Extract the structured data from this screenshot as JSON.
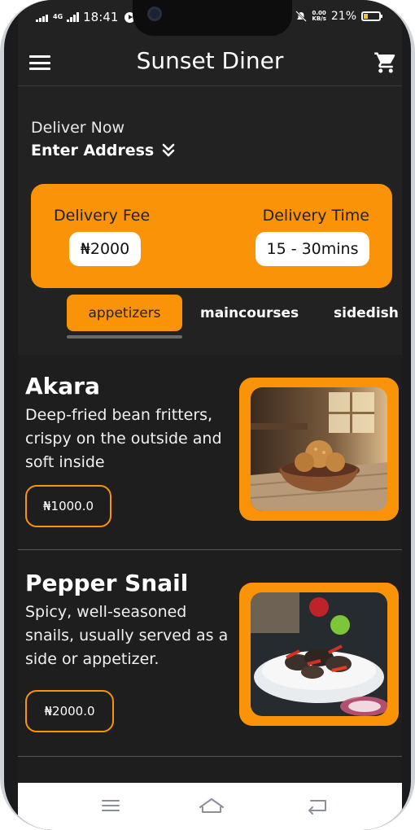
{
  "status_bar": {
    "network": "4G",
    "time": "18:41",
    "speed_top": "0.00",
    "speed_bottom": "KB/s",
    "battery": "21%"
  },
  "app": {
    "title": "Sunset Diner"
  },
  "delivery": {
    "deliver_now": "Deliver Now",
    "address": "Enter Address",
    "fee_label": "Delivery Fee",
    "fee_value": "₦2000",
    "time_label": "Delivery Time",
    "time_value": "15 - 30mins"
  },
  "tabs": [
    {
      "label": "appetizers",
      "active": true
    },
    {
      "label": "maincourses",
      "active": false
    },
    {
      "label": "sidedish",
      "active": false
    }
  ],
  "items": [
    {
      "name": "Akara",
      "description": "Deep-fried bean fritters, crispy on the outside and soft inside",
      "price": "₦1000.0"
    },
    {
      "name": "Pepper Snail",
      "description": "Spicy, well-seasoned snails, usually served as a side or appetizer.",
      "price": "₦2000.0"
    }
  ],
  "colors": {
    "accent": "#fa9307",
    "background": "#222222"
  },
  "icons": {
    "menu": "menu-icon",
    "cart": "cart-icon",
    "address_toggle": "double-chevron-down-icon",
    "nav_recent": "recent-apps-icon",
    "nav_home": "home-icon",
    "nav_back": "back-icon"
  }
}
